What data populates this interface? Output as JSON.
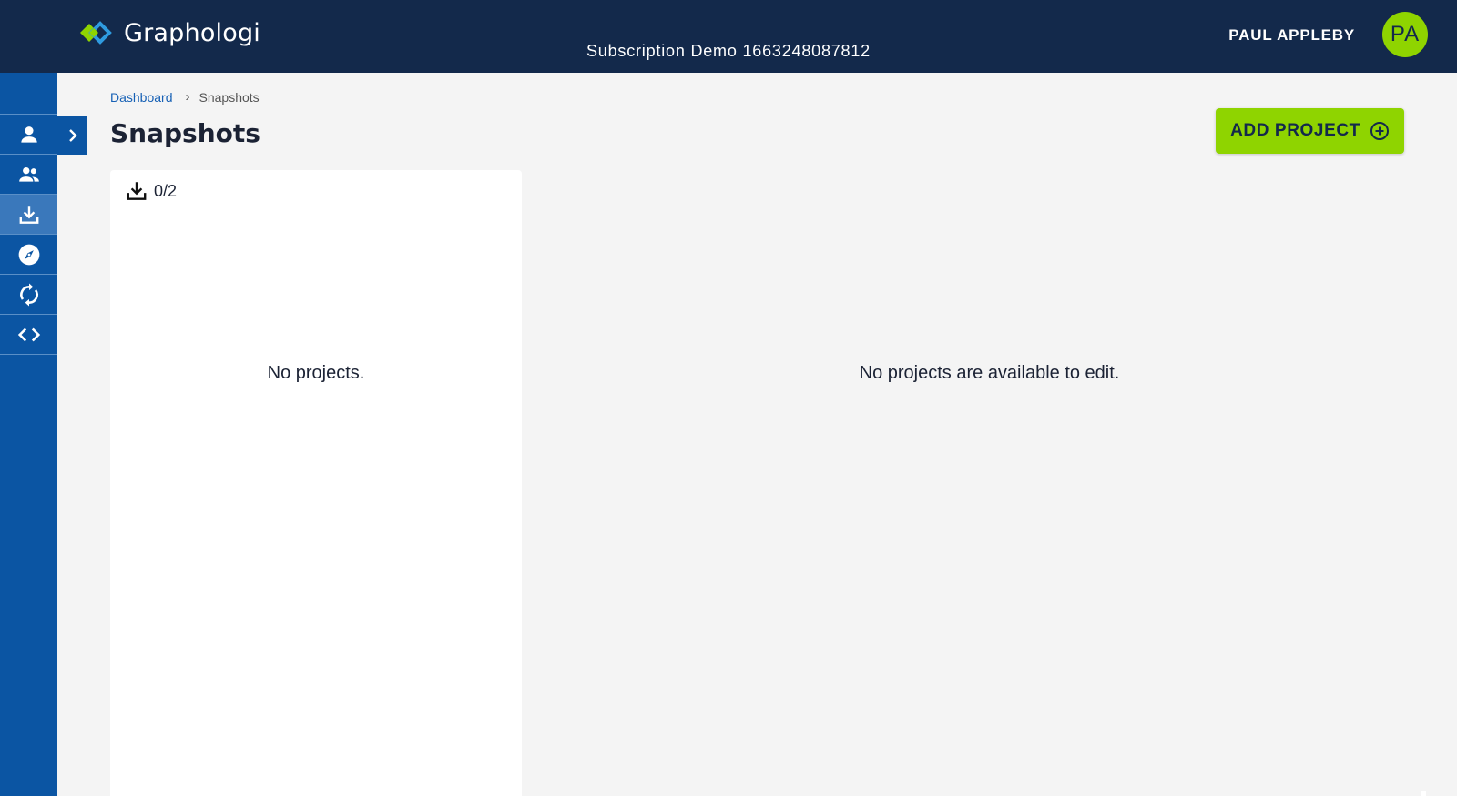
{
  "header": {
    "app_name": "Graphologi",
    "subscription": "Subscription Demo 1663248087812",
    "user_name": "PAUL APPLEBY",
    "user_initials": "PA"
  },
  "sidebar": {
    "items": [
      {
        "name": "person-icon"
      },
      {
        "name": "group-icon"
      },
      {
        "name": "download-icon",
        "active": true
      },
      {
        "name": "compass-icon"
      },
      {
        "name": "sync-icon"
      },
      {
        "name": "code-icon"
      }
    ],
    "expand_icon": "chevron-right-icon"
  },
  "breadcrumb": {
    "home": "Dashboard",
    "current": "Snapshots"
  },
  "page": {
    "title": "Snapshots",
    "add_button": "ADD PROJECT"
  },
  "panel": {
    "count": "0/2",
    "empty_text": "No projects."
  },
  "main": {
    "empty_text": "No projects are available to edit."
  },
  "colors": {
    "header_bg": "#13294b",
    "sidebar_bg": "#0b55a3",
    "accent": "#8fd400",
    "link": "#1660b5"
  }
}
